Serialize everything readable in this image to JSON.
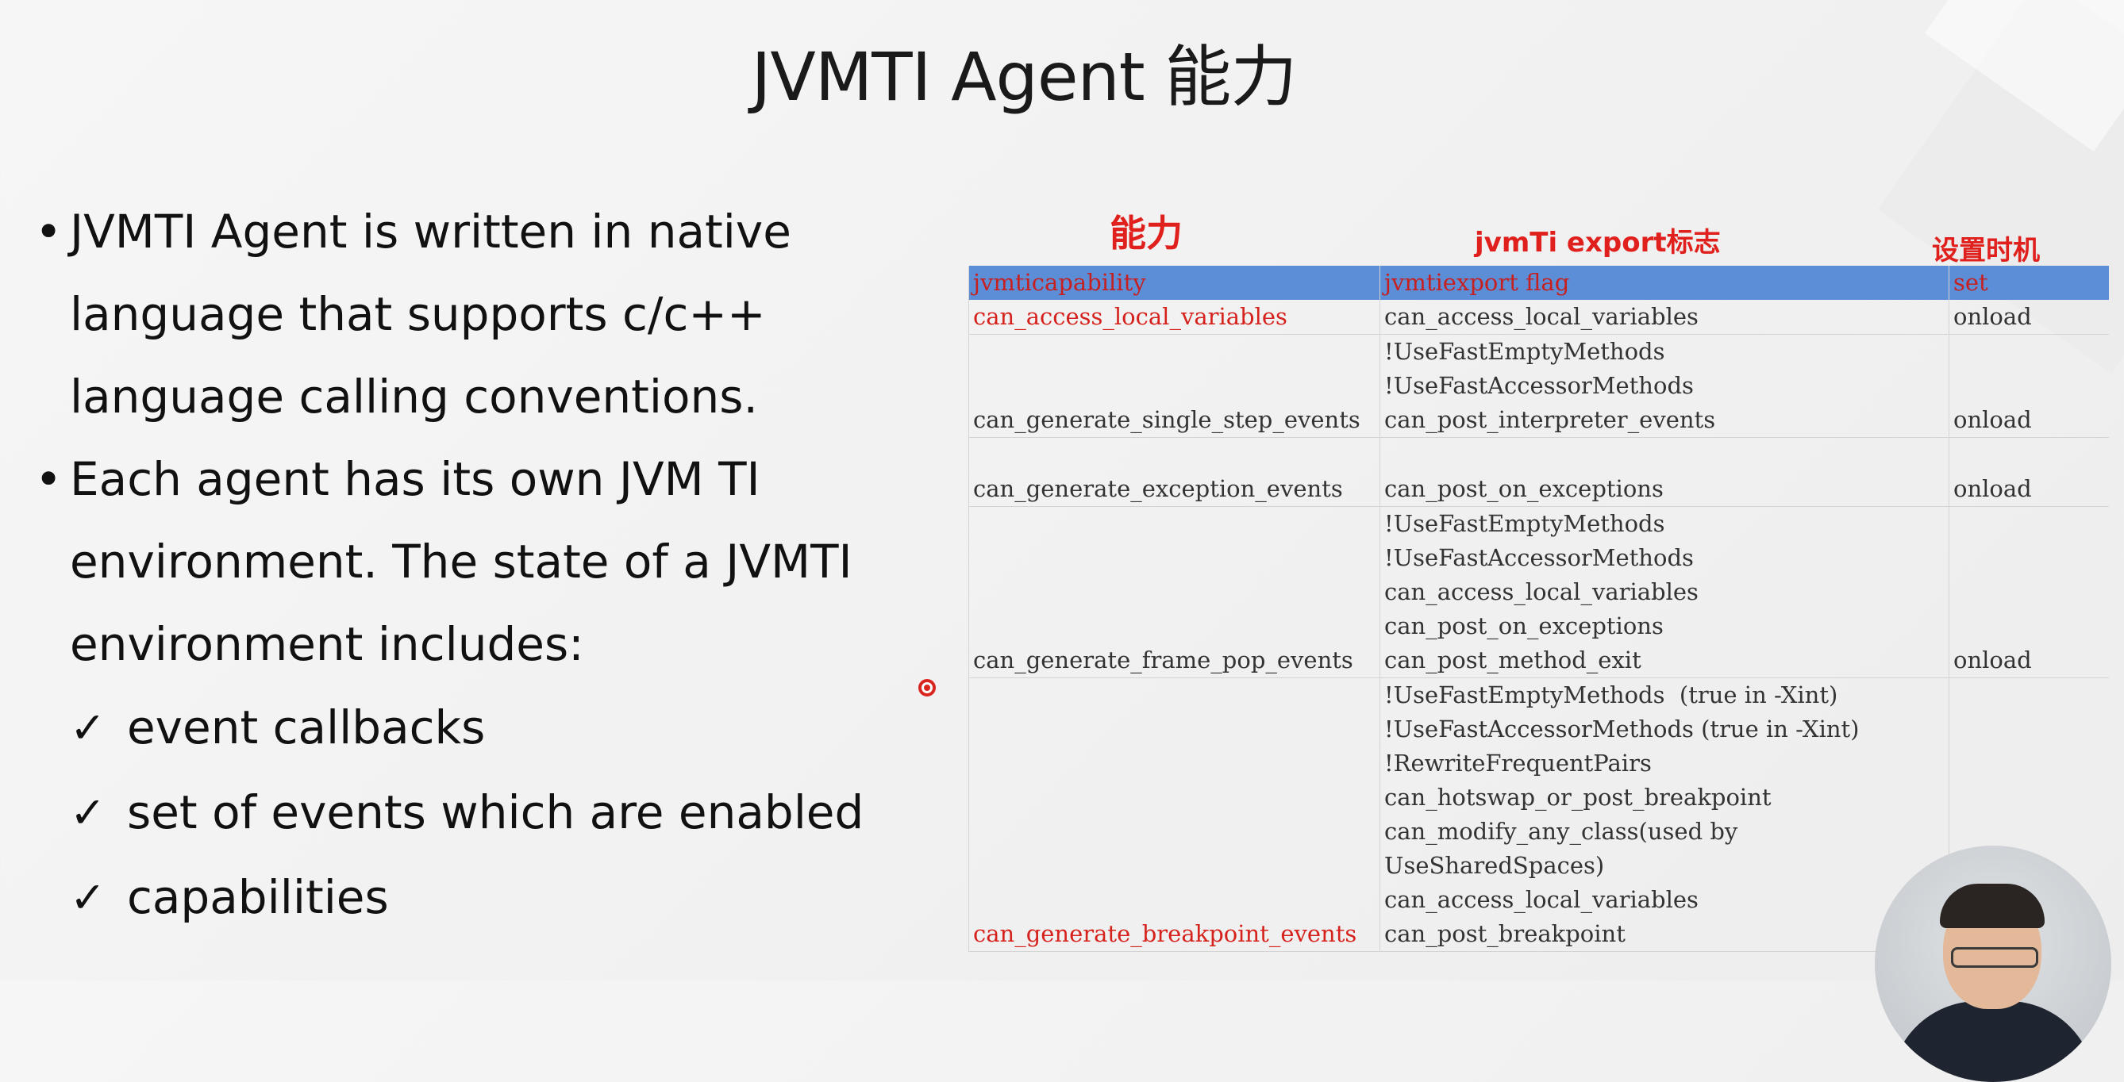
{
  "title": "JVMTI Agent 能力",
  "bullets": [
    "JVMTI Agent is written in native language that supports c/c++ language calling conventions.",
    "Each agent has its own JVM TI environment. The state of a JVMTI environment includes:"
  ],
  "sub_items": [
    "event callbacks",
    "set of events which are enabled",
    "capabilities"
  ],
  "check_glyph": "✓",
  "bullet_glyph": "•",
  "column_headers": [
    "能力",
    "jvmTi export标志",
    "设置时机"
  ],
  "table": {
    "header": [
      "jvmticapability",
      "jvmtiexport flag",
      "set"
    ],
    "rows": [
      {
        "capability": "can_access_local_variables",
        "flags": "can_access_local_variables",
        "set": "onload",
        "highlight": true
      },
      {
        "capability": "can_generate_single_step_events",
        "flags": "!UseFastEmptyMethods\n!UseFastAccessorMethods\ncan_post_interpreter_events",
        "set": "onload",
        "highlight": false
      },
      {
        "capability": "can_generate_exception_events",
        "flags": "\ncan_post_on_exceptions",
        "set": "onload",
        "highlight": false
      },
      {
        "capability": "can_generate_frame_pop_events",
        "flags": "!UseFastEmptyMethods\n!UseFastAccessorMethods\ncan_access_local_variables\ncan_post_on_exceptions\ncan_post_method_exit",
        "set": "onload",
        "highlight": false
      },
      {
        "capability": "can_generate_breakpoint_events",
        "flags": "!UseFastEmptyMethods  (true in -Xint)\n!UseFastAccessorMethods (true in -Xint)\n!RewriteFrequentPairs\ncan_hotswap_or_post_breakpoint\ncan_modify_any_class(used by\nUseSharedSpaces)\ncan_access_local_variables\ncan_post_breakpoint",
        "set": "",
        "highlight": true
      }
    ]
  },
  "colors": {
    "header_bg": "#5b8ed6",
    "accent_red": "#d6221d",
    "text": "#333333"
  },
  "icons": [
    "record-indicator-icon",
    "presenter-video"
  ]
}
